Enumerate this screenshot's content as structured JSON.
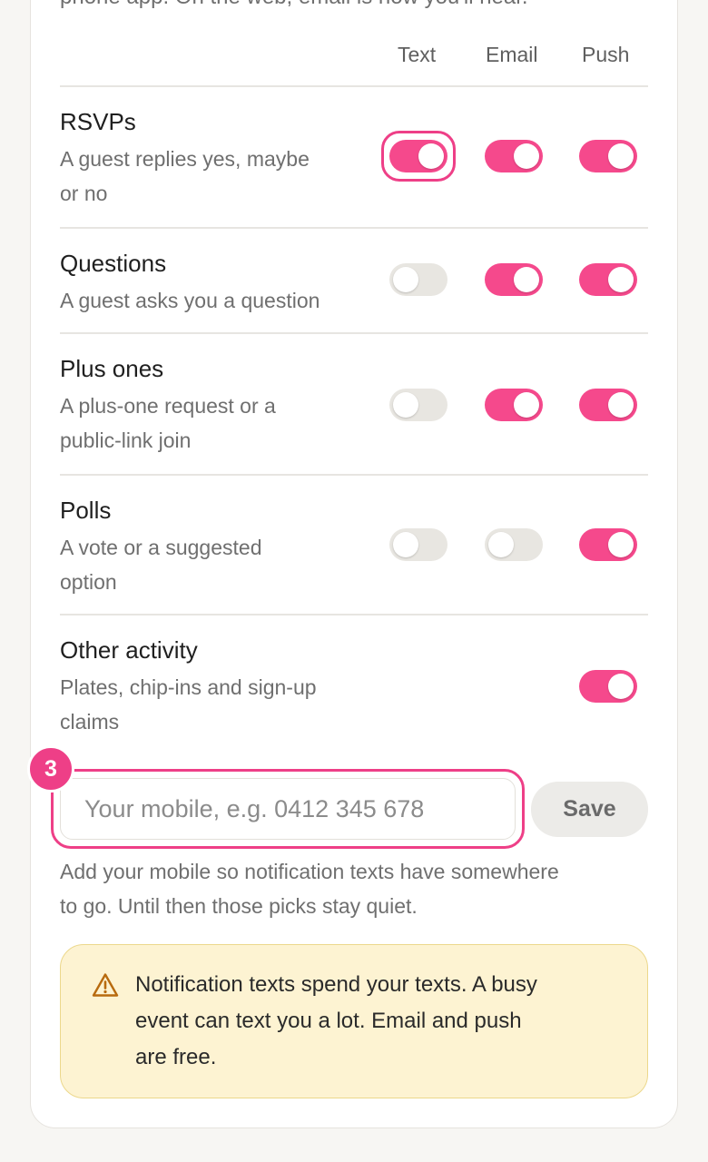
{
  "intro_text": "phone app. On the web, email is how you'll hear.",
  "columns": [
    "Text",
    "Email",
    "Push"
  ],
  "rows": [
    {
      "title": "RSVPs",
      "desc_line1": "A guest replies yes, maybe",
      "desc_line2": "or no",
      "text_on": true,
      "email_on": true,
      "push_on": true,
      "text_focused": true
    },
    {
      "title": "Questions",
      "desc_line1": "A guest asks you a question",
      "desc_line2": "",
      "text_on": false,
      "email_on": true,
      "push_on": true
    },
    {
      "title": "Plus ones",
      "desc_line1": "A plus-one request or a",
      "desc_line2": "public-link join",
      "text_on": false,
      "email_on": true,
      "push_on": true
    },
    {
      "title": "Polls",
      "desc_line1": "A vote or a suggested",
      "desc_line2": "option",
      "text_on": false,
      "email_on": false,
      "push_on": true
    },
    {
      "title": "Other activity",
      "desc_line1": "Plates, chip-ins and sign-up",
      "desc_line2": "claims",
      "push_on": true
    }
  ],
  "mobile": {
    "step_number": "3",
    "placeholder": "Your mobile, e.g. 0412 345 678",
    "value": "",
    "save_label": "Save",
    "help_line1": "Add your mobile so notification texts have somewhere",
    "help_line2": "to go. Until then those picks stay quiet."
  },
  "warning": {
    "icon": "warning-triangle-icon",
    "line1": "Notification texts spend your texts. A busy",
    "line2": "event can text you a lot. Email and push",
    "line3": "are free."
  },
  "colors": {
    "accent": "#f5498c",
    "focus": "#ee3f87",
    "toggle_off": "#e8e6e1",
    "warning_bg": "#fdf3d2",
    "warning_border": "#ecd88c",
    "warning_icon": "#b86a0e"
  }
}
